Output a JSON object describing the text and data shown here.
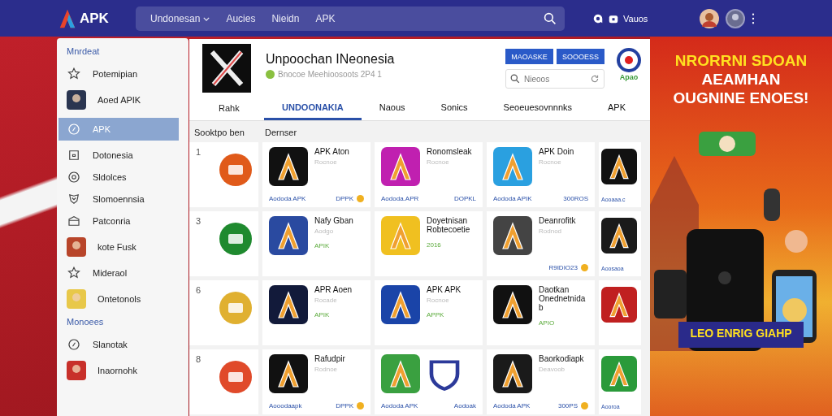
{
  "header": {
    "logo": "APK",
    "nav": [
      {
        "label": "Undonesan",
        "dropdown": true
      },
      {
        "label": "Aucies",
        "dropdown": false
      },
      {
        "label": "Nieidn",
        "dropdown": false
      },
      {
        "label": "APK",
        "dropdown": false
      }
    ],
    "account": "Vauos"
  },
  "sidebar": {
    "sections": [
      {
        "title": "Mnrdeat",
        "items": [
          {
            "label": "Potemipian",
            "kind": "outline",
            "selected": false
          },
          {
            "label": "Aoed APIK",
            "kind": "tile",
            "color": "#2a3550",
            "selected": false
          },
          {
            "label": "APK",
            "kind": "outline",
            "selected": true
          },
          {
            "label": "Dotonesia",
            "kind": "outline",
            "selected": false
          },
          {
            "label": "Sldolces",
            "kind": "outline",
            "selected": false
          },
          {
            "label": "Slomoennsia",
            "kind": "outline",
            "selected": false
          },
          {
            "label": "Patconria",
            "kind": "outline",
            "selected": false
          },
          {
            "label": "kote Fusk",
            "kind": "tile",
            "color": "#b8452a",
            "selected": false
          },
          {
            "label": "Mideraol",
            "kind": "outline",
            "selected": false
          },
          {
            "label": "Ontetonols",
            "kind": "tile",
            "color": "#e8c84a",
            "selected": false
          }
        ]
      },
      {
        "title": "Monoees",
        "items": [
          {
            "label": "Slanotak",
            "kind": "outline",
            "selected": false
          },
          {
            "label": "Inaornohk",
            "kind": "tile",
            "color": "#c8302a",
            "selected": false
          }
        ]
      }
    ]
  },
  "app": {
    "logo": "Rahk",
    "title": "Unpoochan INeonesia",
    "subtitle": "Bnocoe Meehioosoots 2P4 1",
    "buttons": [
      "MAOASKE",
      "SOOOESS"
    ],
    "search_placeholder": "Nieoos",
    "badge": "Apao"
  },
  "tabs": [
    {
      "label": "UNDOONAKIA",
      "selected": true
    },
    {
      "label": "Naous",
      "selected": false
    },
    {
      "label": "Sonics",
      "selected": false
    },
    {
      "label": "Seoeuesovnnnks",
      "selected": false
    },
    {
      "label": "APK",
      "selected": false
    }
  ],
  "sections": [
    "Sooktpo ben",
    "Dernser"
  ],
  "rows": [
    {
      "rank": "1",
      "color": "#e05a1a",
      "cards": [
        {
          "name": "APK Aton",
          "sub": "Rocnoe",
          "left": "Aododa APK",
          "right": "DPPK",
          "coin": true,
          "color": "#111111"
        },
        {
          "name": "Ronomsleak",
          "sub": "Rocnoe",
          "left": "Aododa.APR",
          "right": "DOPKL",
          "coin": false,
          "color": "#c020b0"
        },
        {
          "name": "APK Doin",
          "sub": "Rocnoe",
          "left": "Aododa APIK",
          "right": "300ROS",
          "coin": false,
          "color": "#2aa0e0"
        },
        {
          "left": "Aooaaa.c",
          "coin": false,
          "color": "#111111"
        }
      ]
    },
    {
      "rank": "3",
      "color": "#1f8a2f",
      "cards": [
        {
          "name": "Nafy Gban",
          "sub": "Aodgo",
          "tag": "APIK",
          "coin": false,
          "color": "#2a4aa0"
        },
        {
          "name": "Doyetnisan Robtecoetie",
          "tag": "2016",
          "coin": false,
          "color": "#f0c020"
        },
        {
          "name": "Deanrofitk",
          "sub": "Rodnod",
          "right": "R9IDIO23",
          "coin": true,
          "color": "#444444"
        },
        {
          "left": "Aoosaoa",
          "coin": false,
          "color": "#1a1a1a"
        }
      ]
    },
    {
      "rank": "6",
      "color": "#e0b030",
      "cards": [
        {
          "name": "APR Aoen",
          "sub": "Rocade",
          "tag": "APIK",
          "coin": false,
          "color": "#121a3a"
        },
        {
          "name": "APK APK",
          "sub": "Rocnoe",
          "tag": "APPK",
          "coin": false,
          "color": "#1a44a8"
        },
        {
          "name": "Daotkan Onednetnidab",
          "tag": "APIO",
          "coin": false,
          "color": "#111111"
        },
        {
          "coin": false,
          "color": "#c02020"
        }
      ]
    },
    {
      "rank": "8",
      "color": "#e04a2a",
      "cards": [
        {
          "name": "Rafudpir",
          "sub": "Rodnoe",
          "left": "Aooodaapk",
          "right": "DPPK",
          "coin": true,
          "color": "#111111"
        },
        {
          "left": "Aododa APK",
          "right": "Aodoak",
          "coin": false,
          "color": "#3aa040",
          "shield": true
        },
        {
          "name": "Baorkodiapk",
          "sub": "Deavoob",
          "left": "Aododa APK",
          "right": "300PS",
          "coin": true,
          "color": "#1a1a1a"
        },
        {
          "left": "Aooroa",
          "coin": false,
          "color": "#2a9a3a"
        }
      ]
    }
  ],
  "ad": {
    "headline": [
      "NRORRNI SDOAN",
      "AEAMHAN",
      "OUGNINE ENOES!"
    ],
    "caption": "LEO ENRIG GIAHP"
  }
}
